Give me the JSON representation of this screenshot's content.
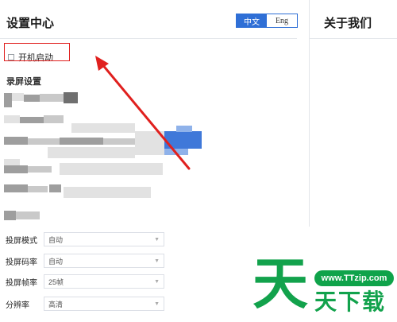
{
  "settings_panel": {
    "title": "设置中心",
    "language_toggle": {
      "chinese_label": "中文",
      "english_label": "Eng",
      "selected": "中文"
    },
    "autostart": {
      "label": "开机启动",
      "checked": false
    },
    "record_section_title": "录屏设置"
  },
  "about_panel": {
    "title": "关于我们"
  },
  "projection_settings": [
    {
      "label": "投屏模式",
      "value": "自动"
    },
    {
      "label": "投屏码率",
      "value": "自动"
    },
    {
      "label": "投屏帧率",
      "value": "25帧"
    },
    {
      "label": "分辨率",
      "value": "高清"
    }
  ],
  "watermark": {
    "url": "www.TTzip.com",
    "big_char": "天",
    "text": "天下载"
  },
  "colors": {
    "accent": "#2f6fd6",
    "annotation_red": "#e0201e",
    "watermark_green": "#12a24c"
  }
}
